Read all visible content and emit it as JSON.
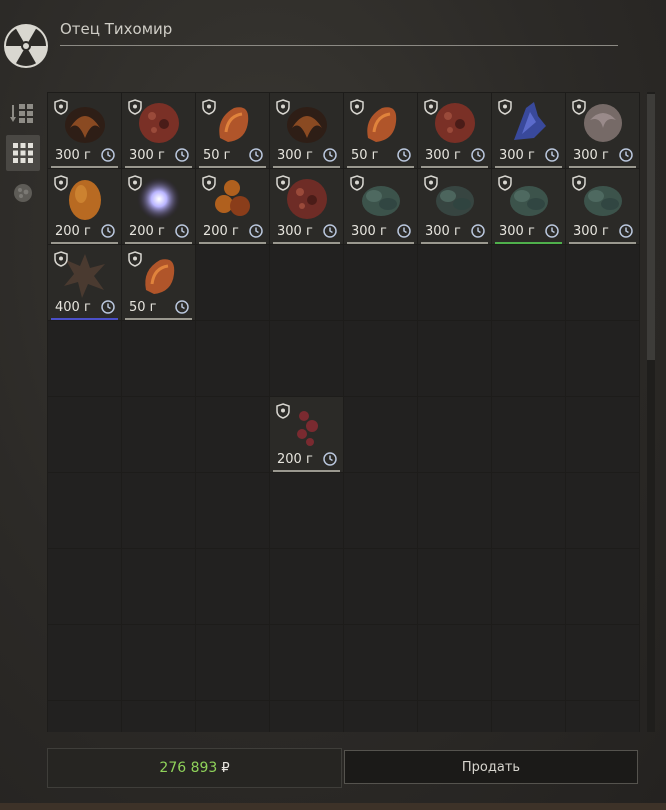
{
  "window": {
    "title": "Отец Тихомир"
  },
  "sidebar": {
    "tabs": [
      {
        "icon": "sort-list-icon",
        "active": false
      },
      {
        "icon": "grid-icon",
        "active": true
      },
      {
        "icon": "artifact-icon",
        "active": false
      }
    ]
  },
  "grid": {
    "columns": 8,
    "rows": 9,
    "items": [
      {
        "row": 0,
        "col": 0,
        "price": "300 г",
        "icon": "artifact-dark-orange",
        "color": "#8a4a22"
      },
      {
        "row": 0,
        "col": 1,
        "price": "300 г",
        "icon": "artifact-red-round",
        "color": "#7a3026"
      },
      {
        "row": 0,
        "col": 2,
        "price": "50 г",
        "icon": "artifact-orange-twist",
        "color": "#b0552a"
      },
      {
        "row": 0,
        "col": 3,
        "price": "300 г",
        "icon": "artifact-dark-orange",
        "color": "#8a4a22"
      },
      {
        "row": 0,
        "col": 4,
        "price": "50 г",
        "icon": "artifact-orange-twist",
        "color": "#b0552a"
      },
      {
        "row": 0,
        "col": 5,
        "price": "300 г",
        "icon": "artifact-red-round",
        "color": "#7a3026"
      },
      {
        "row": 0,
        "col": 6,
        "price": "300 г",
        "icon": "artifact-blue-crystal",
        "color": "#3b4ca8"
      },
      {
        "row": 0,
        "col": 7,
        "price": "300 г",
        "icon": "artifact-grey-rose",
        "color": "#8a7a78"
      },
      {
        "row": 1,
        "col": 0,
        "price": "200 г",
        "icon": "artifact-amber-pod",
        "color": "#b86a22"
      },
      {
        "row": 1,
        "col": 1,
        "price": "200 г",
        "icon": "artifact-glowing-orb",
        "color": "#c7c3ff"
      },
      {
        "row": 1,
        "col": 2,
        "price": "200 г",
        "icon": "artifact-orange-cluster",
        "color": "#b0601e"
      },
      {
        "row": 1,
        "col": 3,
        "price": "300 г",
        "icon": "artifact-red-round",
        "color": "#6e2c26"
      },
      {
        "row": 1,
        "col": 4,
        "price": "300 г",
        "icon": "artifact-green-leaf",
        "color": "#3f5a52"
      },
      {
        "row": 1,
        "col": 5,
        "price": "300 г",
        "icon": "artifact-green-leaf",
        "color": "#3a4a46"
      },
      {
        "row": 1,
        "col": 6,
        "price": "300 г",
        "icon": "artifact-green-leaf",
        "color": "#3f5a52",
        "highlight": "green"
      },
      {
        "row": 1,
        "col": 7,
        "price": "300 г",
        "icon": "artifact-green-leaf",
        "color": "#3f5a52"
      },
      {
        "row": 2,
        "col": 0,
        "price": "400 г",
        "icon": "artifact-dark-spiky",
        "color": "#4a3a30",
        "highlight": "blue"
      },
      {
        "row": 2,
        "col": 1,
        "price": "50 г",
        "icon": "artifact-orange-twist",
        "color": "#b0552a"
      },
      {
        "row": 4,
        "col": 3,
        "price": "200 г",
        "icon": "artifact-red-spots",
        "color": "#7a2a30"
      }
    ]
  },
  "footer": {
    "money": "276 893",
    "currency": "₽",
    "sell_label": "Продать"
  }
}
